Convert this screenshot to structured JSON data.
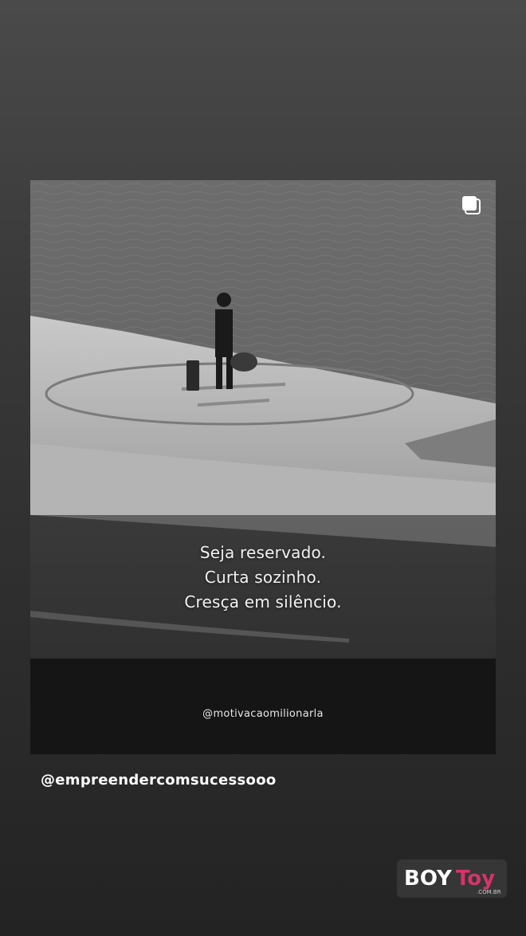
{
  "story": {
    "quote_lines": [
      "Seja reservado.",
      "Curta sozinho.",
      "Cresça em silêncio."
    ],
    "post_handle": "@motivacaomilionarla",
    "multi_icon": "carousel-icon"
  },
  "mention": "@empreendercomsucessooo",
  "watermark": {
    "brand_part1": "BOY",
    "brand_part2": "Toy",
    "domain": ".COM.BR",
    "accent_color": "#d6336c"
  }
}
